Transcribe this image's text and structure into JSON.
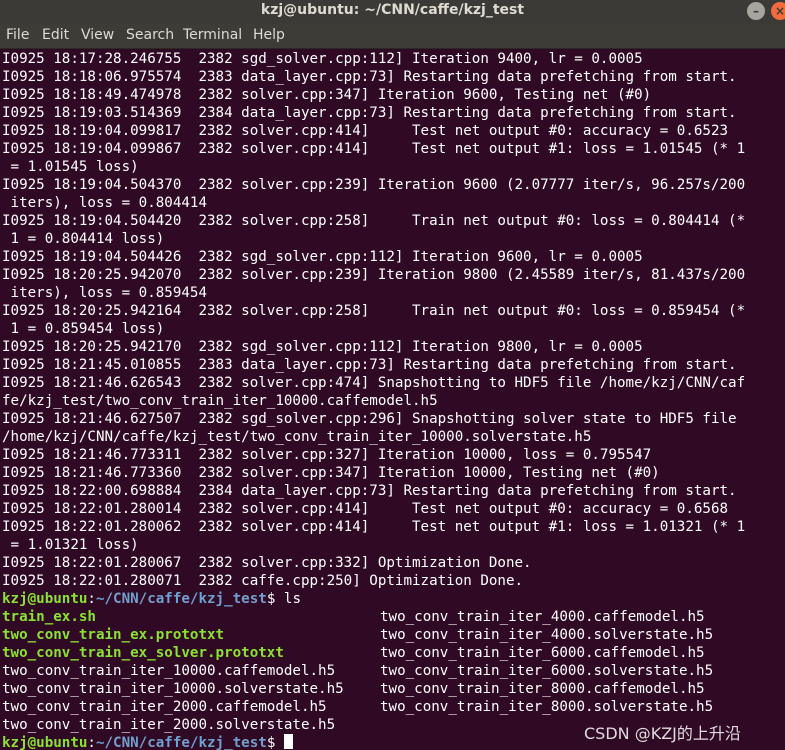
{
  "window": {
    "title": "kzj@ubuntu: ~/CNN/caffe/kzj_test",
    "min_glyph": "–",
    "close_glyph": "×"
  },
  "menu": [
    "File",
    "Edit",
    "View",
    "Search",
    "Terminal",
    "Help"
  ],
  "log_lines": [
    "I0925 18:17:28.246755  2382 sgd_solver.cpp:112] Iteration 9400, lr = 0.0005",
    "I0925 18:18:06.975574  2383 data_layer.cpp:73] Restarting data prefetching from start.",
    "I0925 18:18:49.474978  2382 solver.cpp:347] Iteration 9600, Testing net (#0)",
    "I0925 18:19:03.514369  2384 data_layer.cpp:73] Restarting data prefetching from start.",
    "I0925 18:19:04.099817  2382 solver.cpp:414]     Test net output #0: accuracy = 0.6523",
    "I0925 18:19:04.099867  2382 solver.cpp:414]     Test net output #1: loss = 1.01545 (* 1",
    " = 1.01545 loss)",
    "I0925 18:19:04.504370  2382 solver.cpp:239] Iteration 9600 (2.07777 iter/s, 96.257s/200",
    " iters), loss = 0.804414",
    "I0925 18:19:04.504420  2382 solver.cpp:258]     Train net output #0: loss = 0.804414 (*",
    " 1 = 0.804414 loss)",
    "I0925 18:19:04.504426  2382 sgd_solver.cpp:112] Iteration 9600, lr = 0.0005",
    "I0925 18:20:25.942070  2382 solver.cpp:239] Iteration 9800 (2.45589 iter/s, 81.437s/200",
    " iters), loss = 0.859454",
    "I0925 18:20:25.942164  2382 solver.cpp:258]     Train net output #0: loss = 0.859454 (*",
    " 1 = 0.859454 loss)",
    "I0925 18:20:25.942170  2382 sgd_solver.cpp:112] Iteration 9800, lr = 0.0005",
    "I0925 18:21:45.010855  2383 data_layer.cpp:73] Restarting data prefetching from start.",
    "I0925 18:21:46.626543  2382 solver.cpp:474] Snapshotting to HDF5 file /home/kzj/CNN/caf",
    "fe/kzj_test/two_conv_train_iter_10000.caffemodel.h5",
    "I0925 18:21:46.627507  2382 sgd_solver.cpp:296] Snapshotting solver state to HDF5 file",
    "/home/kzj/CNN/caffe/kzj_test/two_conv_train_iter_10000.solverstate.h5",
    "I0925 18:21:46.773311  2382 solver.cpp:327] Iteration 10000, loss = 0.795547",
    "I0925 18:21:46.773360  2382 solver.cpp:347] Iteration 10000, Testing net (#0)",
    "I0925 18:22:00.698884  2384 data_layer.cpp:73] Restarting data prefetching from start.",
    "I0925 18:22:01.280014  2382 solver.cpp:414]     Test net output #0: accuracy = 0.6568",
    "I0925 18:22:01.280062  2382 solver.cpp:414]     Test net output #1: loss = 1.01321 (* 1",
    " = 1.01321 loss)",
    "I0925 18:22:01.280067  2382 solver.cpp:332] Optimization Done.",
    "I0925 18:22:01.280071  2382 caffe.cpp:250] Optimization Done."
  ],
  "prompt": {
    "user_host": "kzj@ubuntu",
    "sep": ":",
    "path": "~/CNN/caffe/kzj_test",
    "symbol": "$ "
  },
  "command": "ls",
  "ls_left": [
    {
      "name": "train_ex.sh",
      "exec": true
    },
    {
      "name": "two_conv_train_ex.prototxt",
      "exec": true
    },
    {
      "name": "two_conv_train_ex_solver.prototxt",
      "exec": true
    },
    {
      "name": "two_conv_train_iter_10000.caffemodel.h5",
      "exec": false
    },
    {
      "name": "two_conv_train_iter_10000.solverstate.h5",
      "exec": false
    },
    {
      "name": "two_conv_train_iter_2000.caffemodel.h5",
      "exec": false
    },
    {
      "name": "two_conv_train_iter_2000.solverstate.h5",
      "exec": false
    }
  ],
  "ls_right": [
    {
      "name": "two_conv_train_iter_4000.caffemodel.h5",
      "exec": false
    },
    {
      "name": "two_conv_train_iter_4000.solverstate.h5",
      "exec": false
    },
    {
      "name": "two_conv_train_iter_6000.caffemodel.h5",
      "exec": false
    },
    {
      "name": "two_conv_train_iter_6000.solverstate.h5",
      "exec": false
    },
    {
      "name": "two_conv_train_iter_8000.caffemodel.h5",
      "exec": false
    },
    {
      "name": "two_conv_train_iter_8000.solverstate.h5",
      "exec": false
    }
  ],
  "watermark": "CSDN @KZJ的上升沿",
  "colors": {
    "background": "#300A24",
    "text": "#FFFFFF",
    "prompt_user": "#8AE234",
    "prompt_path": "#729FCF",
    "titlebar": "#3B3A36"
  }
}
